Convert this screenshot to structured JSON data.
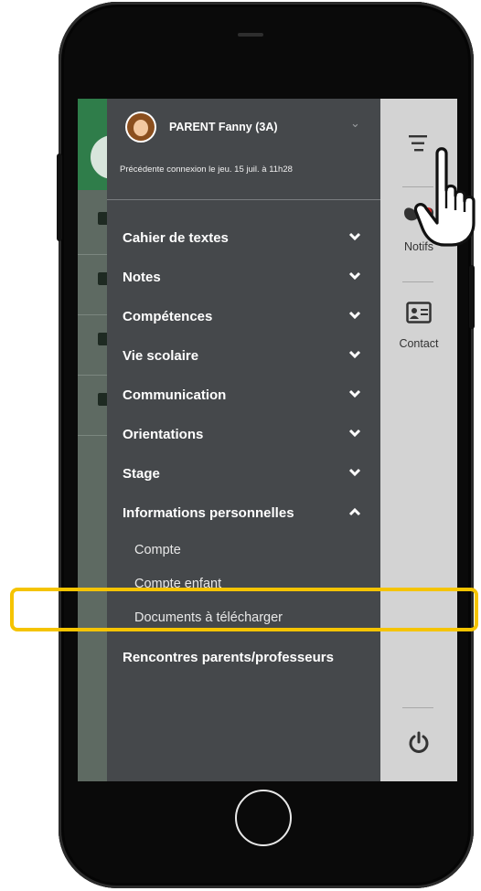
{
  "profile": {
    "name": "PARENT Fanny (3A)",
    "last_login": "Précédente connexion le jeu. 15 juil. à 11h28"
  },
  "menu": {
    "items": [
      {
        "label": "Cahier de textes"
      },
      {
        "label": "Notes"
      },
      {
        "label": "Compétences"
      },
      {
        "label": "Vie scolaire"
      },
      {
        "label": "Communication"
      },
      {
        "label": "Orientations"
      },
      {
        "label": "Stage"
      },
      {
        "label": "Informations personnelles"
      }
    ],
    "sub_items": [
      {
        "label": "Compte"
      },
      {
        "label": "Compte enfant"
      },
      {
        "label": "Documents à télécharger"
      }
    ],
    "last_item": {
      "label": "Rencontres parents/professeurs"
    }
  },
  "rail": {
    "notifs_label": "Notifs",
    "contact_label": "Contact"
  },
  "colors": {
    "drawer_bg": "#45484b",
    "rail_bg": "#d3d3d3",
    "highlight": "#f5c400"
  },
  "icons": [
    "avatar",
    "chevron-down-icon",
    "chevron-up-icon",
    "hamburger-menu-icon",
    "butterfly-notif-icon",
    "contact-card-icon",
    "power-icon",
    "pointer-hand-icon",
    "pdf-icon"
  ]
}
